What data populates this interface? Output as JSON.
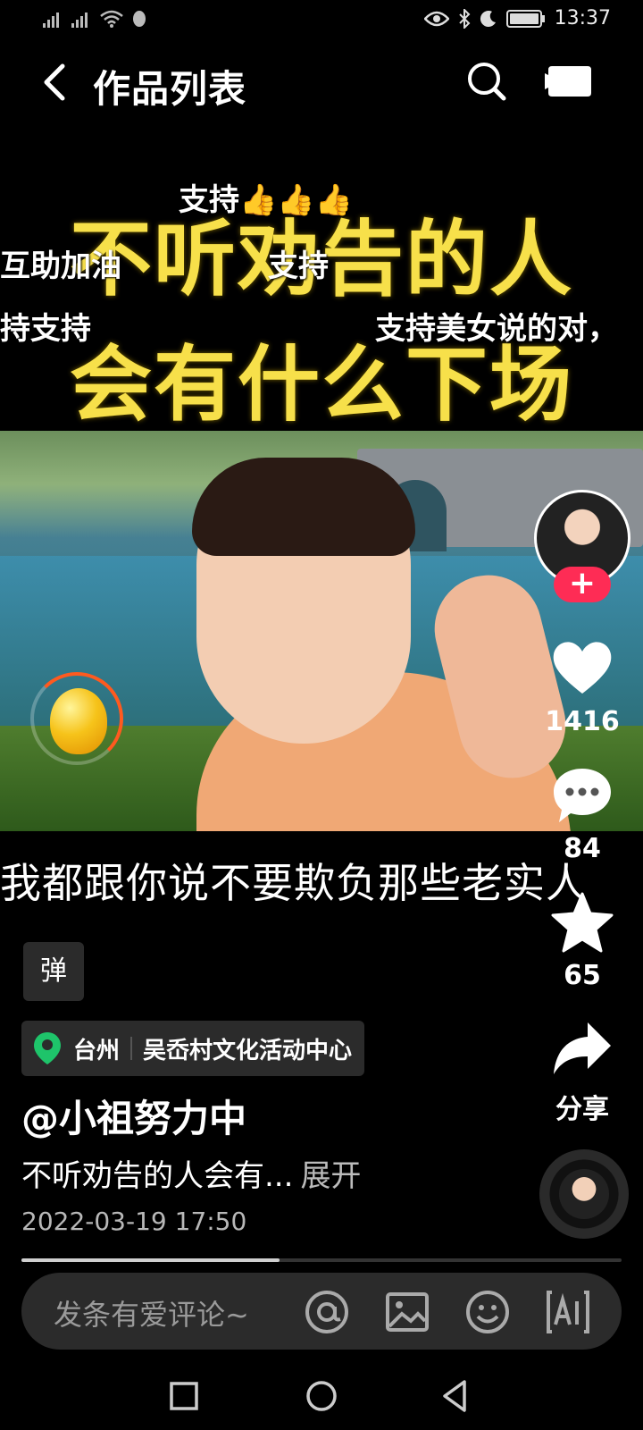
{
  "status_bar": {
    "time": "13:37"
  },
  "header": {
    "title": "作品列表"
  },
  "banner": {
    "title_line1": "不听劝告的人",
    "title_line2": "会有什么下场",
    "danmu": [
      "支持👍👍👍",
      "互助加油",
      "支持",
      "持支持",
      "支持美女说的对，"
    ]
  },
  "video": {
    "subtitle": "我都跟你说不要欺负那些老实人"
  },
  "rail": {
    "like_count": "1416",
    "comment_count": "84",
    "favorite_count": "65",
    "share_label": "分享",
    "follow_symbol": "+"
  },
  "info": {
    "music_tag": "弹",
    "location_city": "台州",
    "location_place": "吴岙村文化活动中心",
    "author": "@小祖努力中",
    "description": "不听劝告的人会有...",
    "expand_label": "展开",
    "date": "2022-03-19 17:50",
    "progress": 0.43
  },
  "comment_bar": {
    "placeholder": "发条有爱评论~"
  },
  "colors": {
    "accent": "#fe2c55",
    "title_yellow": "#f7e04a",
    "location_pin": "#1ec46a"
  }
}
